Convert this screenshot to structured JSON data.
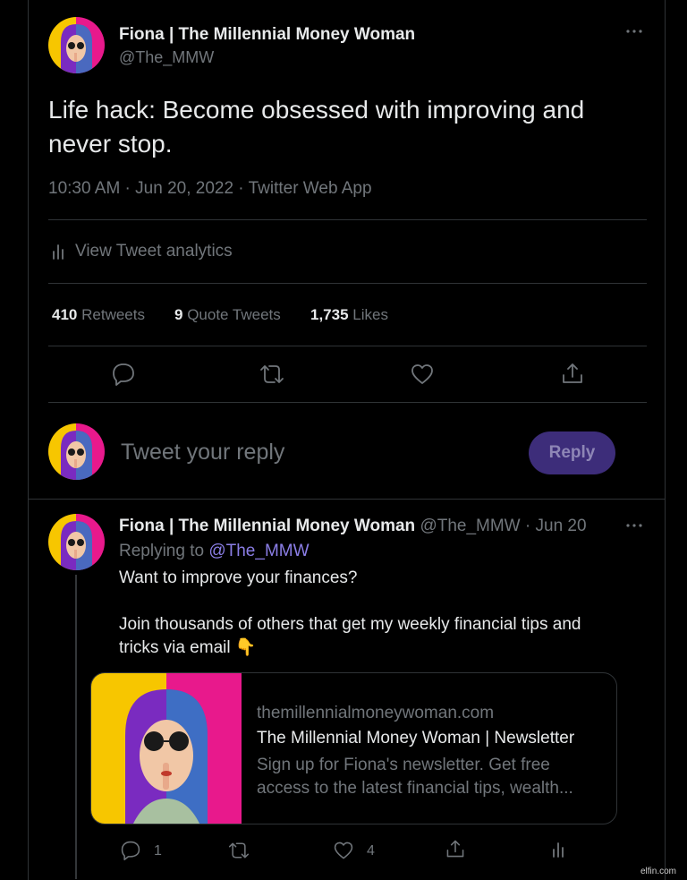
{
  "main_tweet": {
    "author_name": "Fiona | The Millennial Money Woman",
    "handle": "@The_MMW",
    "more_icon": "more-icon",
    "text_line1": "Life hack: Become obsessed with improving and",
    "text_line2": "never stop.",
    "meta": "10:30 AM · Jun 20, 2022 · Twitter Web App",
    "analytics_label": "View Tweet analytics",
    "stats": {
      "retweets_count": "410",
      "retweets_label": "Retweets",
      "quotes_count": "9",
      "quotes_label": "Quote Tweets",
      "likes_count": "1,735",
      "likes_label": "Likes"
    },
    "actions": [
      "reply-icon",
      "retweet-icon",
      "like-icon",
      "share-icon"
    ]
  },
  "composer": {
    "placeholder": "Tweet your reply",
    "reply_button": "Reply"
  },
  "reply_tweet": {
    "author_name": "Fiona | The Millennial Money Woman",
    "handle_date": "@The_MMW · Jun 20",
    "replying_prefix": "Replying to ",
    "replying_handle": "@The_MMW",
    "text_line1": "Want to improve your finances?",
    "text_line2": "Join thousands of others that get my weekly financial tips and",
    "text_line3": "tricks via email 👇",
    "card": {
      "domain": "themillennialmoneywoman.com",
      "title": "The Millennial Money Woman | Newsletter",
      "desc_line1": "Sign up for Fiona's newsletter. Get free",
      "desc_line2": "access to the latest financial tips, wealth..."
    },
    "reply_count": "1",
    "like_count": "4"
  },
  "watermark": "elfin.com",
  "colors": {
    "accent": "#8b7ee6",
    "reply_button_bg": "#3d2d7a",
    "border": "#2f3336",
    "muted": "#71767b"
  }
}
